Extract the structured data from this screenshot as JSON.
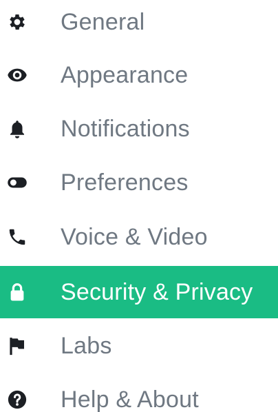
{
  "sidebar": {
    "active_color": "#1abc84",
    "items": [
      {
        "label": "General",
        "icon": "gear-icon",
        "active": false
      },
      {
        "label": "Appearance",
        "icon": "eye-icon",
        "active": false
      },
      {
        "label": "Notifications",
        "icon": "bell-icon",
        "active": false
      },
      {
        "label": "Preferences",
        "icon": "toggle-icon",
        "active": false
      },
      {
        "label": "Voice & Video",
        "icon": "phone-icon",
        "active": false
      },
      {
        "label": "Security & Privacy",
        "icon": "lock-icon",
        "active": true
      },
      {
        "label": "Labs",
        "icon": "flag-icon",
        "active": false
      },
      {
        "label": "Help & About",
        "icon": "help-icon",
        "active": false
      }
    ]
  }
}
